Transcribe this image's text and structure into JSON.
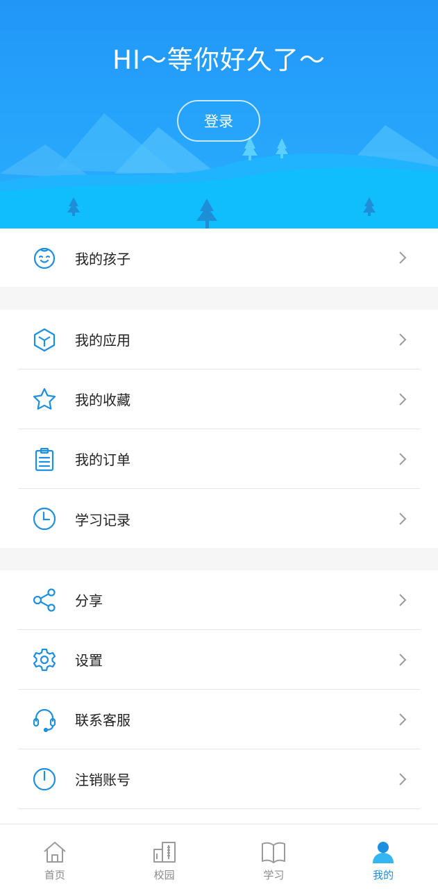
{
  "header": {
    "greeting": "HI～等你好久了～",
    "login_label": "登录"
  },
  "menu_groups": [
    {
      "items": [
        {
          "label": "我的孩子",
          "icon": "baby-face-icon"
        }
      ]
    },
    {
      "items": [
        {
          "label": "我的应用",
          "icon": "cube-icon"
        },
        {
          "label": "我的收藏",
          "icon": "star-icon"
        },
        {
          "label": "我的订单",
          "icon": "clipboard-icon"
        },
        {
          "label": "学习记录",
          "icon": "clock-icon"
        }
      ]
    },
    {
      "items": [
        {
          "label": "分享",
          "icon": "share-icon"
        },
        {
          "label": "设置",
          "icon": "gear-icon"
        },
        {
          "label": "联系客服",
          "icon": "headset-icon"
        },
        {
          "label": "注销账号",
          "icon": "power-icon"
        }
      ]
    }
  ],
  "bottom_nav": [
    {
      "label": "首页",
      "icon": "home-icon",
      "active": false
    },
    {
      "label": "校园",
      "icon": "campus-icon",
      "active": false
    },
    {
      "label": "学习",
      "icon": "book-icon",
      "active": false
    },
    {
      "label": "我的",
      "icon": "user-icon",
      "active": true
    }
  ],
  "colors": {
    "accent": "#1c8fe0",
    "header_top": "#2196f8",
    "header_bottom": "#12bdfd",
    "text": "#222222",
    "inactive": "#8a8a8a"
  }
}
